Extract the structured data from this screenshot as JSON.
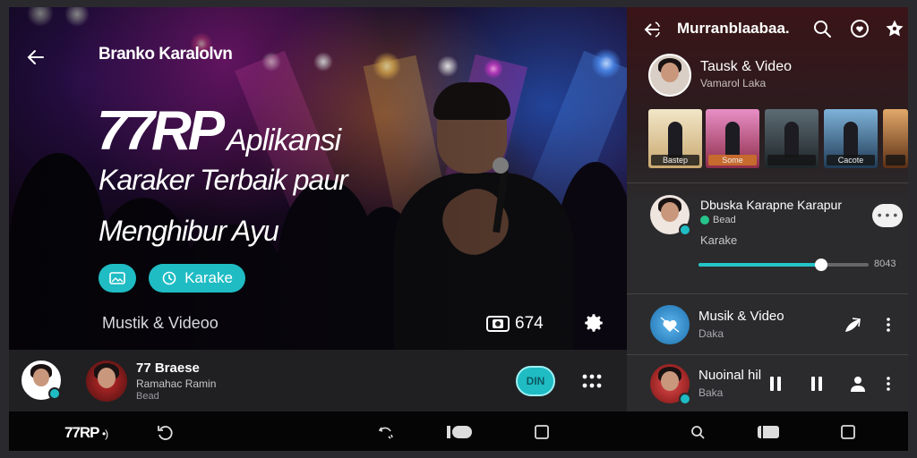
{
  "hero": {
    "brand": "Branko Karalolvn",
    "logo": "77RP",
    "headline_1": "Aplikansi",
    "headline_2": "Karaker Terbaik paur",
    "headline_3": "Menghibur Ayu",
    "chip_2_label": "Karake",
    "subtitle": "Mustik & Videoo",
    "views": "674"
  },
  "mini_player": {
    "title": "77 Braese",
    "artist": "Ramahac Ramin",
    "sub": "Bead",
    "play_label": "DIN"
  },
  "system_bar": {
    "logo": "77RP",
    "logo_suffix": "•)"
  },
  "panel": {
    "title": "Murranblaabaa.",
    "hero_title": "Tausk & Video",
    "hero_sub": "Vamarol Laka",
    "thumbs": [
      "Bastep",
      "Some",
      "",
      "Cacote",
      ""
    ],
    "now_playing": {
      "title": "Dbuska Karapne Karapur",
      "tag": "Bead",
      "sub": "Karake",
      "more": "• • •",
      "progress": 0.72,
      "time": "8043"
    },
    "rows": [
      {
        "title": "Musik & Video",
        "sub": "Daka"
      },
      {
        "title": "Nuoinal hil",
        "sub": "Baka"
      }
    ]
  },
  "colors": {
    "accent": "#1fbcc4",
    "panel_top": "#3a1417",
    "panel_base": "#2b2b2d"
  }
}
